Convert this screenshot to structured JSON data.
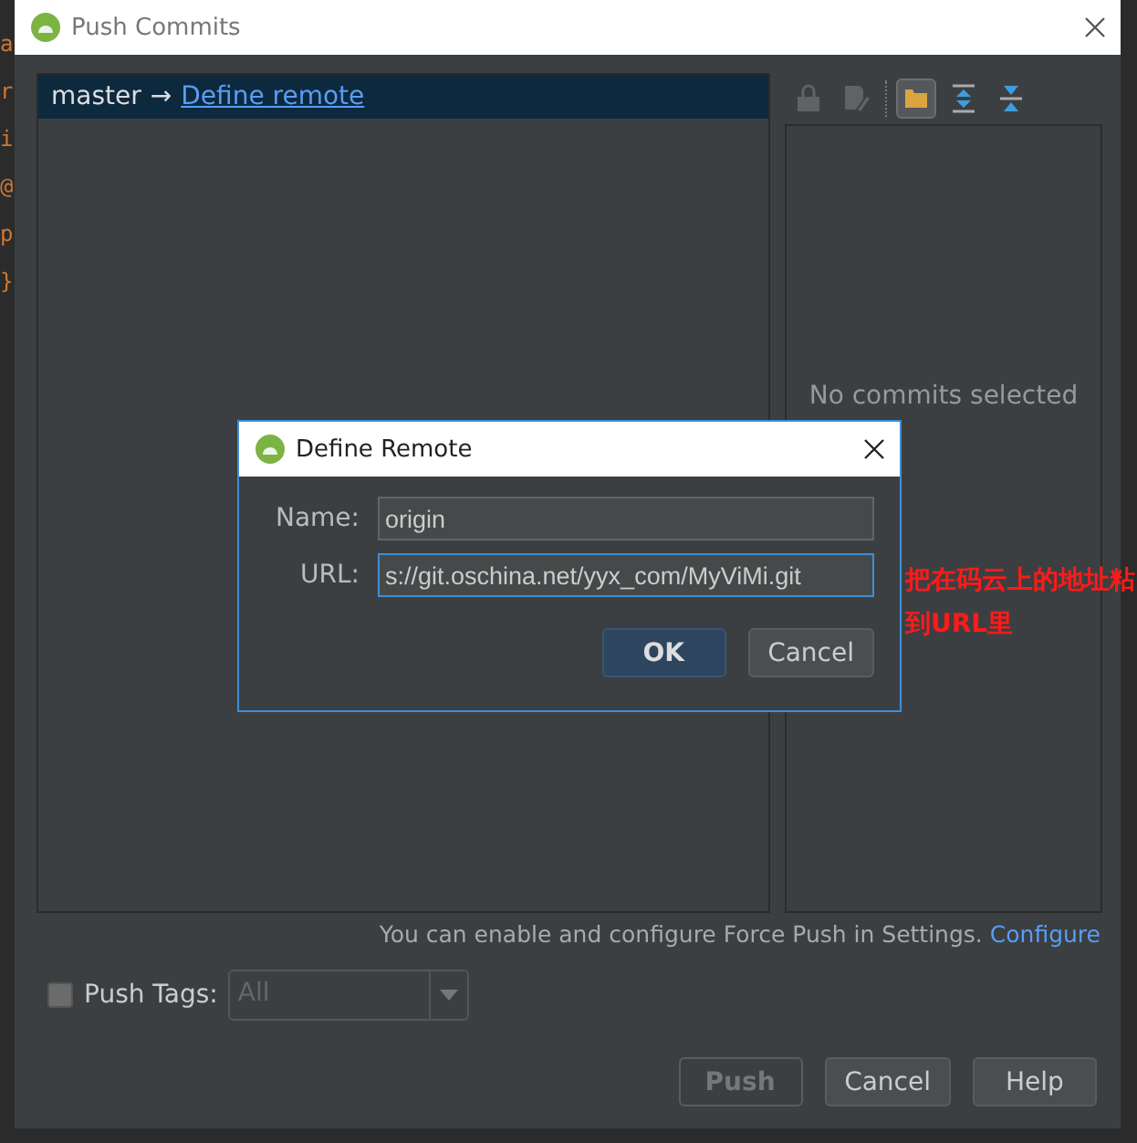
{
  "editor_fragments": [
    "a",
    "r",
    "i",
    "@",
    "p",
    "}"
  ],
  "window": {
    "title": "Push Commits"
  },
  "branch_row": {
    "branch": "master",
    "arrow": "→",
    "link": "Define remote",
    "selected": true
  },
  "toolbar": [
    {
      "kind": "lock",
      "selected": false,
      "disabled": true
    },
    {
      "kind": "edit",
      "selected": false,
      "disabled": true
    },
    {
      "kind": "folder",
      "selected": true,
      "disabled": false
    },
    {
      "kind": "expand",
      "selected": false,
      "disabled": false
    },
    {
      "kind": "collapse",
      "selected": false,
      "disabled": false
    }
  ],
  "details": {
    "empty_text": "No commits selected"
  },
  "note": {
    "text": "You can enable and configure Force Push in Settings.",
    "link": "Configure"
  },
  "push_tags": {
    "checked": false,
    "label": "Push Tags:",
    "value": "All",
    "disabled": true
  },
  "buttons": [
    {
      "label": "Push",
      "disabled": true
    },
    {
      "label": "Cancel",
      "disabled": false
    },
    {
      "label": "Help",
      "disabled": false
    }
  ],
  "define_remote": {
    "title": "Define Remote",
    "fields": [
      {
        "label": "Name:",
        "value": "origin",
        "focused": false
      },
      {
        "label": "URL:",
        "value": "s://git.oschina.net/yyx_com/MyViMi.git",
        "focused": true
      }
    ],
    "buttons": [
      {
        "label": "OK",
        "default": true
      },
      {
        "label": "Cancel",
        "default": false
      }
    ]
  },
  "annotation": "把在码云上的地址粘到URL里"
}
